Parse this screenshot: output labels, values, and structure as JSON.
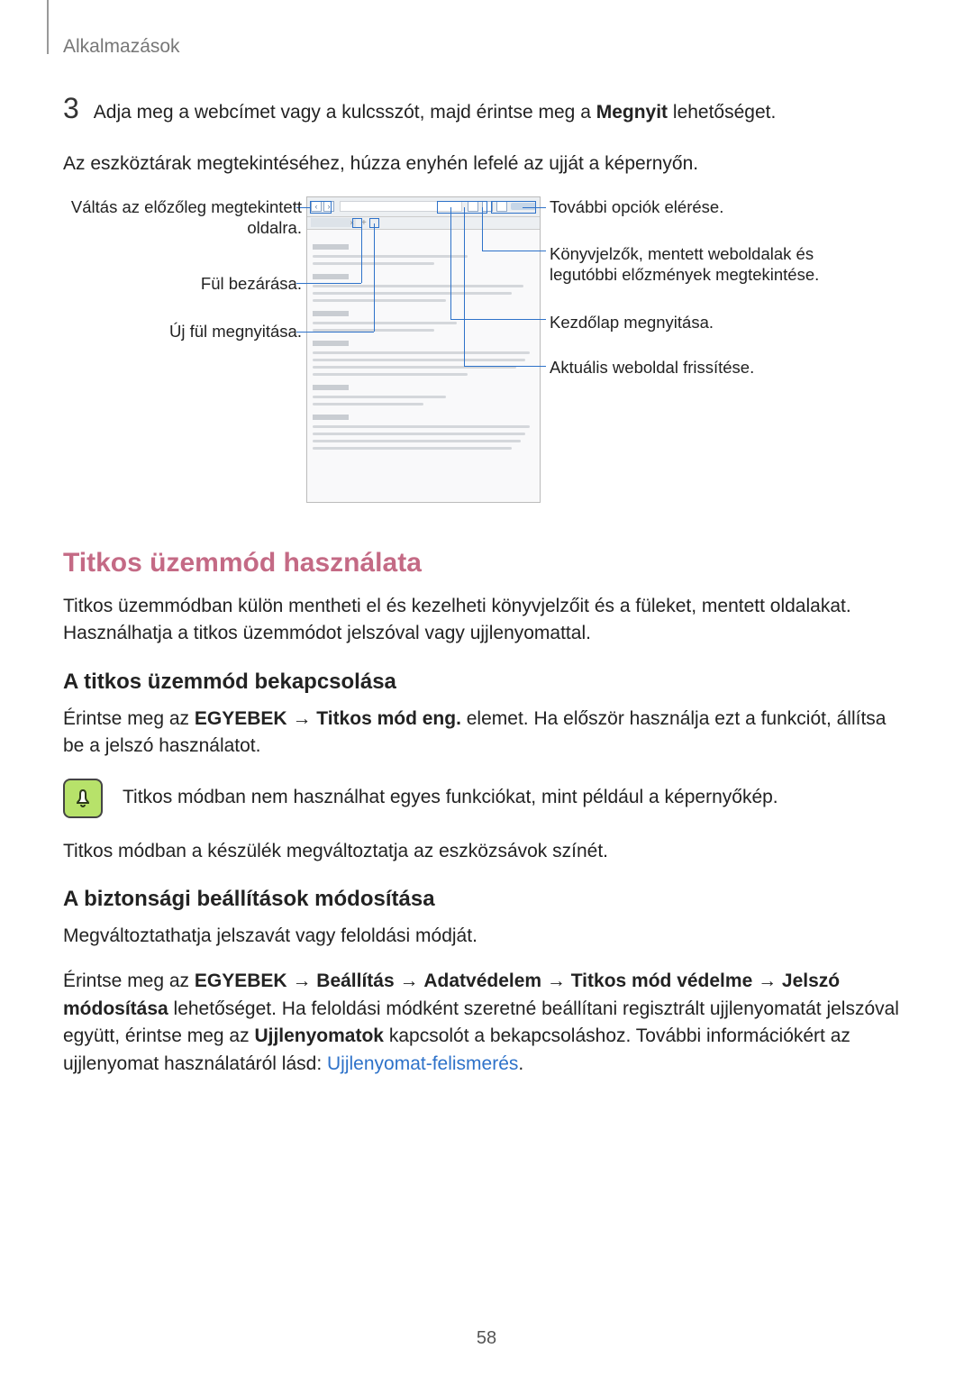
{
  "header": "Alkalmazások",
  "step3": {
    "num": "3",
    "pre": "Adja meg a webcímet vagy a kulcsszót, majd érintse meg a ",
    "bold": "Megnyit",
    "post": " lehetőséget."
  },
  "toolbars_para": "Az eszköztárak megtekintéséhez, húzza enyhén lefelé az ujját a képernyőn.",
  "callouts": {
    "left1": "Váltás az előzőleg megtekintett oldalra.",
    "left2": "Fül bezárása.",
    "left3": "Új fül megnyitása.",
    "right1": "További opciók elérése.",
    "right2": "Könyvjelzők, mentett weboldalak és legutóbbi előzmények megtekintése.",
    "right3": "Kezdőlap megnyitása.",
    "right4": "Aktuális weboldal frissítése."
  },
  "sec_title": "Titkos üzemmód használata",
  "sec_intro": "Titkos üzemmódban külön mentheti el és kezelheti könyvjelzőit és a füleket, mentett oldalakat. Használhatja a titkos üzemmódot jelszóval vagy ujjlenyomattal.",
  "sub1": "A titkos üzemmód bekapcsolása",
  "sub1_p1_pre": "Érintse meg az ",
  "sub1_p1_b1": "EGYEBEK",
  "sub1_p1_arrow": " → ",
  "sub1_p1_b2": "Titkos mód eng.",
  "sub1_p1_post": " elemet. Ha először használja ezt a funkciót, állítsa be a jelszó használatot.",
  "note_text": "Titkos módban nem használhat egyes funkciókat, mint például a képernyőkép.",
  "sub1_p2": "Titkos módban a készülék megváltoztatja az eszközsávok színét.",
  "sub2": "A biztonsági beállítások módosítása",
  "sub2_p1": "Megváltoztathatja jelszavát vagy feloldási módját.",
  "sub2_p2": {
    "pre": "Érintse meg az ",
    "b1": "EGYEBEK",
    "a1": " → ",
    "b2": "Beállítás",
    "a2": " → ",
    "b3": "Adatvédelem",
    "a3": " → ",
    "b4": "Titkos mód védelme",
    "a4": " → ",
    "b5": "Jelszó módosítása",
    "mid1": " lehetőséget. Ha feloldási módként szeretné beállítani regisztrált ujjlenyomatát jelszóval együtt, érintse meg az ",
    "b6": "Ujjlenyomatok",
    "mid2": " kapcsolót a bekapcsoláshoz. További információkért az ujjlenyomat használatáról lásd: ",
    "link": "Ujjlenyomat-felismerés",
    "tail": "."
  },
  "page_num": "58"
}
